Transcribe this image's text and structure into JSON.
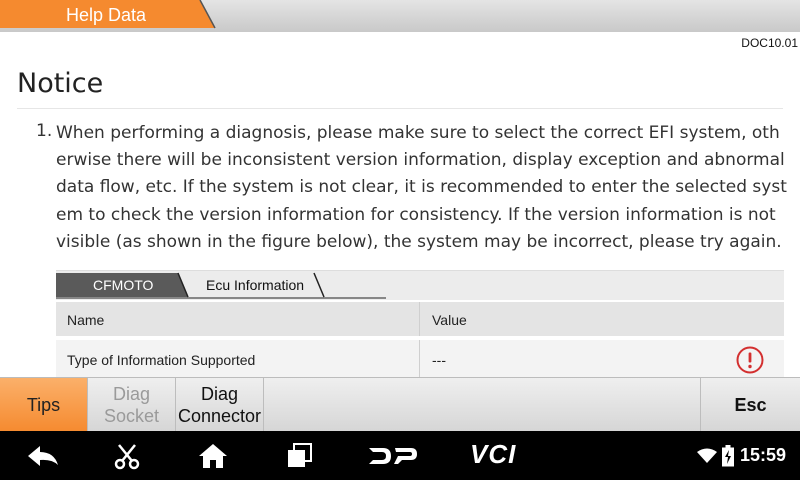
{
  "header": {
    "tab_label": "Help Data",
    "accent": "#f58a2f"
  },
  "doc": {
    "id": "DOC10.01",
    "title": "Notice",
    "item_number": "1.",
    "paragraph": "When performing a diagnosis, please make sure to select the correct EFI system, otherwise there will be inconsistent version information, display exception and abnormal data flow, etc. If the system is not clear, it is recommended to enter the selected system to check the version information for consistency. If the version information is not visible (as shown in the figure below), the system may be incorrect, please try again."
  },
  "figure": {
    "breadcrumb": [
      "CFMOTO",
      "Ecu Information"
    ],
    "columns": [
      "Name",
      "Value"
    ],
    "rows": [
      {
        "name": "Type of Information Supported",
        "value": "---",
        "icon": "warning-circle-icon",
        "icon_color": "#d32f2f"
      }
    ]
  },
  "toolbar": {
    "tips": "Tips",
    "diag_socket_line1": "Diag",
    "diag_socket_line2": "Socket",
    "diag_connector_line1": "Diag",
    "diag_connector_line2": "Connector",
    "esc": "Esc"
  },
  "navbar": {
    "icons": [
      "back-icon",
      "scissors-icon",
      "home-icon",
      "recents-icon",
      "dp-icon",
      "vci-icon",
      "wifi-icon",
      "battery-icon"
    ],
    "dp_label": "DP",
    "vci_label": "VCI",
    "time": "15:59"
  }
}
